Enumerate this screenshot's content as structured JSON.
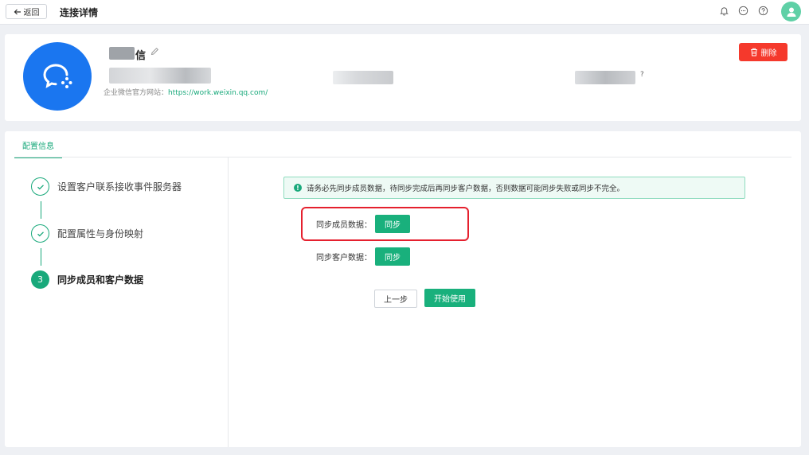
{
  "topbar": {
    "back_label": "返回",
    "title": "连接详情",
    "icons": [
      "bell-icon",
      "message-icon",
      "help-icon",
      "user-avatar-icon"
    ]
  },
  "header": {
    "app_name": "信",
    "website_label": "企业微信官方网站：",
    "website_url": "https://work.weixin.qq.com/",
    "question_mark": "?",
    "delete_label": "删除",
    "logo_icon": "wechat-work-icon"
  },
  "tabs": [
    {
      "label": "配置信息",
      "active": true
    }
  ],
  "steps": [
    {
      "label": "设置客户联系接收事件服务器",
      "status": "done"
    },
    {
      "label": "配置属性与身份映射",
      "status": "done"
    },
    {
      "label": "同步成员和客户数据",
      "status": "active",
      "number": "3"
    }
  ],
  "notice": "请务必先同步成员数据，待同步完成后再同步客户数据，否则数据可能同步失败或同步不完全。",
  "sync": {
    "member_label": "同步成员数据：",
    "member_button": "同步",
    "customer_label": "同步客户数据：",
    "customer_button": "同步"
  },
  "actions": {
    "prev_label": "上一步",
    "start_label": "开始使用"
  },
  "colors": {
    "primary": "#19b07c",
    "danger": "#f5392c",
    "logo": "#1a76f0",
    "highlight": "#e5202e"
  }
}
